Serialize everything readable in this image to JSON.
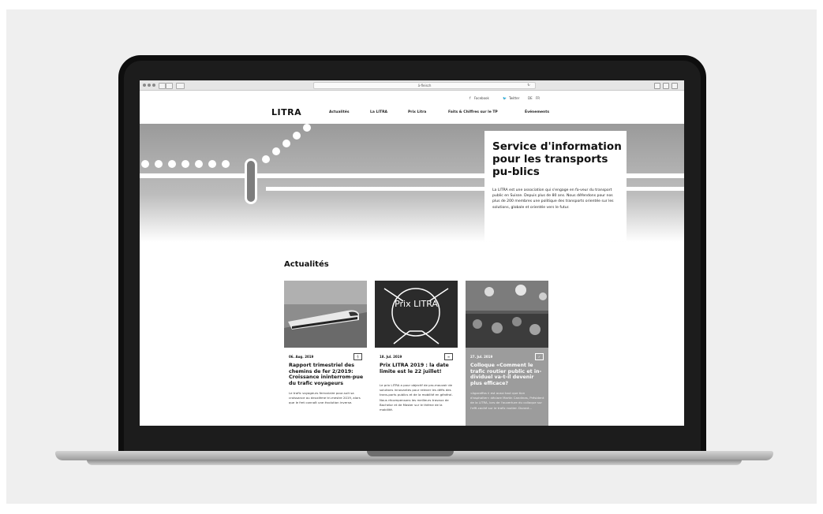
{
  "browser": {
    "url": "ä-fleisch"
  },
  "topbar": {
    "facebook": "Facebook",
    "twitter": "Twitter",
    "lang_de": "DE",
    "lang_fr": "FR"
  },
  "header": {
    "logo": "LITRA",
    "nav": [
      "Actualités",
      "La LITRA",
      "Prix Litra",
      "Faits & Chiffres sur le TP",
      "Événements"
    ]
  },
  "hero": {
    "title": "Service d'information pour les transports pu-blics",
    "text": "La LITRA est une association qui s'engage en fa-veur du transport public en Suisse. Depuis plus de 80 ans. Nous défendons pour nos plus de 200 membres une politique des transports orientée sur les solutions, globale et orientée vers le futur."
  },
  "news": {
    "title": "Actualités",
    "cards": [
      {
        "date": "06. Aug. 2019",
        "title": "Rapport trimestriel des chemins de fer 2/2019: Croissance ininterrom-pue du trafic voyageurs",
        "text": "Le trafic voyageurs ferroviaire pour-suit sa croissance au deuxième tri-mestre 2019, alors que le fret connaît une évolution inverse."
      },
      {
        "date": "18. Jul. 2019",
        "image_text": "Prix LITRA",
        "title": "Prix LITRA 2019 : la date limite est le 22 juillet!",
        "text": "Le prix LITRA a pour objectif de pro-mouvoir de solutions innovantes pour relever les défis des trans-ports publics et de la mobilité en général. Nous récompensons les meilleurs travaux de Bachelor et de Master sur le thème de la mobilité."
      },
      {
        "date": "27. Jul. 2019",
        "title": "Colloque «Comment le trafic routier public et in-dividuel va-t-il devenir plus efficace?",
        "text": "«Agoraffos il est aussi tout que tion d'asphalter» déclare Martin Candinas, Président de la LITRA, lors de l'ouverture du colloque sur l'effi-cacité sur le trafic routier. Durant..."
      }
    ]
  },
  "colors": {
    "background": "#efefef",
    "hero_gray": "#9a9a9a",
    "dark_card": "#9c9c9c"
  }
}
